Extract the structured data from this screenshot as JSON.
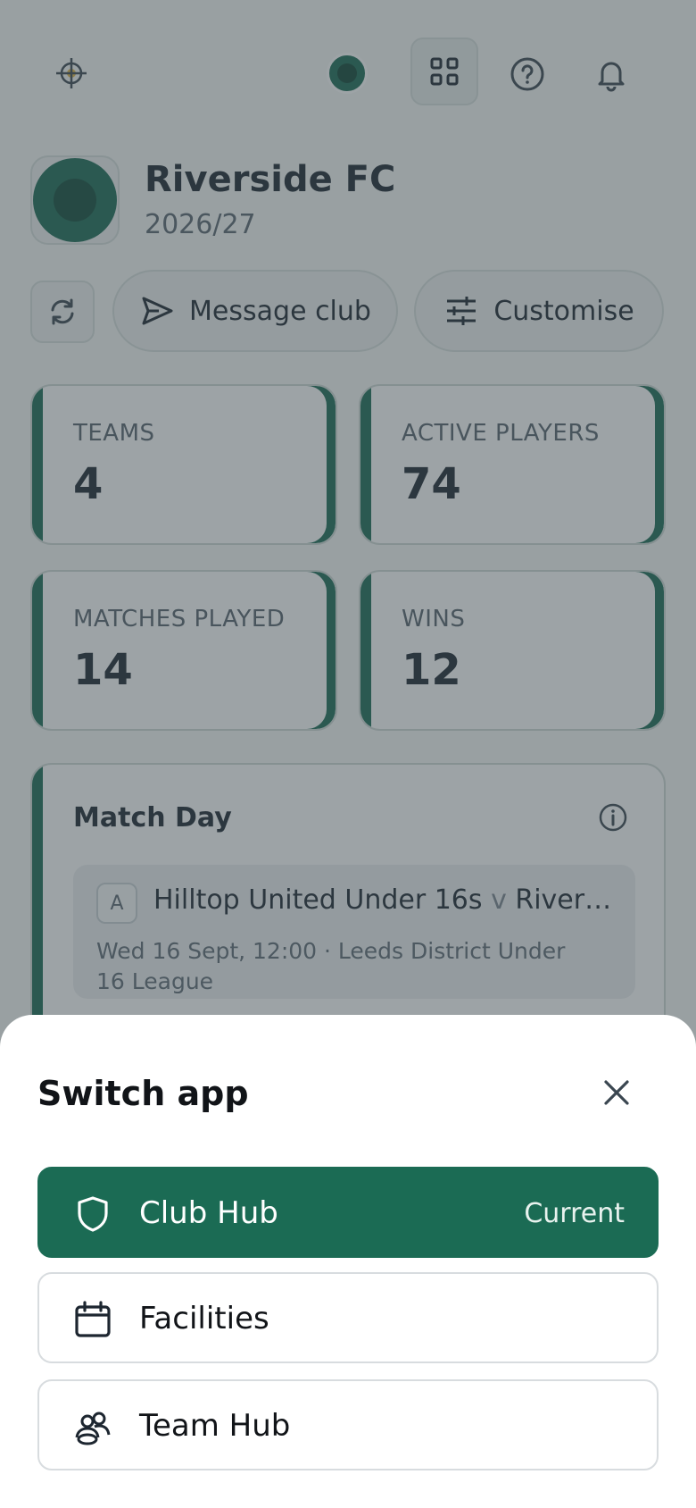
{
  "topbar": {
    "logo_icon": "crosshair-logo-icon",
    "club_avatar_icon": "club-avatar-dot",
    "apps_icon": "grid-apps-icon",
    "help_icon": "help-circle-icon",
    "notifications_icon": "bell-icon"
  },
  "club": {
    "name": "Riverside FC",
    "season": "2026/27"
  },
  "actions": {
    "refresh_icon": "refresh-icon",
    "message_label": "Message club",
    "customise_label": "Customise"
  },
  "stats": [
    {
      "label": "TEAMS",
      "value": "4"
    },
    {
      "label": "ACTIVE PLAYERS",
      "value": "74"
    },
    {
      "label": "MATCHES PLAYED",
      "value": "14"
    },
    {
      "label": "WINS",
      "value": "12"
    }
  ],
  "match_day": {
    "title": "Match Day",
    "fixture": {
      "venue_badge": "A",
      "home": "Hilltop United Under 16s",
      "vs": "v",
      "away": "Riversid...",
      "meta": "Wed 16 Sept, 12:00 · Leeds District Under 16 League"
    }
  },
  "switch_app": {
    "title": "Switch app",
    "apps": [
      {
        "label": "Club Hub",
        "icon": "shield-icon",
        "current_label": "Current"
      },
      {
        "label": "Facilities",
        "icon": "calendar-icon"
      },
      {
        "label": "Team Hub",
        "icon": "team-people-icon"
      }
    ]
  },
  "colors": {
    "brand": "#1b6b54",
    "overlay": "rgba(60,72,78,0.5)"
  }
}
